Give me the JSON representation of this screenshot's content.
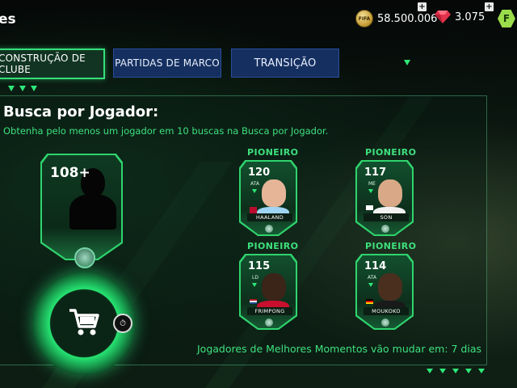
{
  "header": {
    "title_fragment": "es",
    "coins": {
      "value": "58.500.006",
      "icon": "coin-icon",
      "add_label": "+"
    },
    "gems": {
      "value": "3.075",
      "icon": "gem-icon",
      "add_label": "+"
    },
    "fifa_points_label": "F"
  },
  "tabs": [
    {
      "label": "CONSTRUÇÃO DE CLUBE",
      "active": true
    },
    {
      "label": "PARTIDAS DE MARCO",
      "active": false
    },
    {
      "label": "TRANSIÇÃO",
      "active": false
    }
  ],
  "panel": {
    "title": "Busca por Jogador:",
    "subtitle": "Obtenha pelo menos um jogador em 10 buscas na Busca por Jogador.",
    "big_card": {
      "rating": "108+"
    },
    "players": [
      {
        "label": "PIONEIRO",
        "rating": "120",
        "position": "ATA",
        "name": "HAALAND"
      },
      {
        "label": "PIONEIRO",
        "rating": "117",
        "position": "ME",
        "name": "SON"
      },
      {
        "label": "PIONEIRO",
        "rating": "115",
        "position": "LD",
        "name": "FRIMPONG"
      },
      {
        "label": "PIONEIRO",
        "rating": "114",
        "position": "ATA",
        "name": "MOUKOKO"
      }
    ],
    "footer": "Jogadores de Melhores Momentos vão mudar em: 7 dias"
  },
  "colors": {
    "accent": "#2ee879",
    "tab_blue": "#153060",
    "card_green": "#2fd46e"
  }
}
